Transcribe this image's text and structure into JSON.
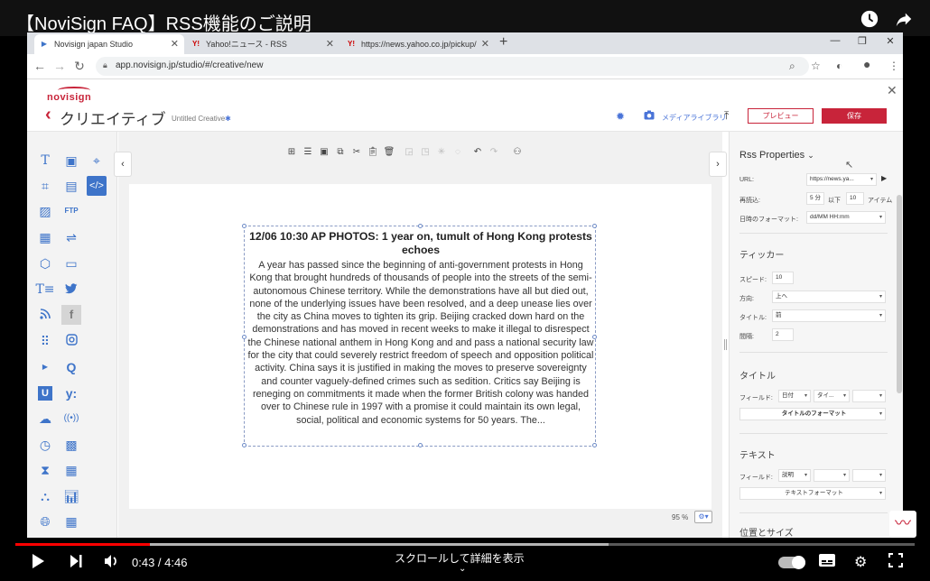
{
  "video": {
    "title": "【NoviSign FAQ】RSS機能のご説明",
    "time_current": "0:43",
    "time_total": "4:46",
    "time_sep": " / ",
    "scroll_hint": "スクロールして詳細を表示",
    "progress": 0.15,
    "buffered": 0.66
  },
  "browser": {
    "tabs": [
      {
        "label": "Novisign japan Studio",
        "icon": "play-icon",
        "active": true
      },
      {
        "label": "Yahoo!ニュース - RSS",
        "icon": "yahoo-icon",
        "active": false
      },
      {
        "label": "https://news.yahoo.co.jp/pickup/",
        "icon": "yahoo-icon",
        "active": false
      }
    ],
    "url": "app.novisign.jp/studio/#/creative/new"
  },
  "app": {
    "logo_text": "novisign",
    "page_title": "クリエイティブ",
    "creative_name": "Untitled Creative",
    "creative_modified_mark": "✱",
    "media_library": "メディアライブラリ",
    "preview_label": "プレビュー",
    "save_label": "保存"
  },
  "canvas": {
    "zoom": "95 %",
    "rss_title": "12/06 10:30 AP PHOTOS: 1 year on, tumult of Hong Kong protests echoes",
    "rss_body": "A year has passed since the beginning of anti-government protests in Hong Kong that brought hundreds of thousands of people into the streets of the semi-autonomous Chinese territory. While the demonstrations have all but died out, none of the underlying issues have been resolved, and a deep unease lies over the city as China moves to tighten its grip. Beijing cracked down hard on the demonstrations and has moved in recent weeks to make it illegal to disrespect the Chinese national anthem in Hong Kong and and pass a national security law for the city that could severely restrict freedom of speech and opposition political activity. China says it is justified in making the moves to preserve sovereignty and counter vaguely-defined crimes such as sedition. Critics say Beijing is reneging on commitments it made when the former British colony was handed over to Chinese rule in 1997 with a promise it could maintain its own legal, social, political and economic systems for 50 years. The..."
  },
  "props": {
    "title": "Rss Properties",
    "url_label": "URL:",
    "url_value": "https://news.ya...",
    "reload_label": "再読込:",
    "reload_minutes": "5",
    "reload_unit": "分",
    "count_prefix": "以下",
    "count_value": "10",
    "count_unit": "アイテム",
    "date_format_label": "日時のフォーマット:",
    "date_format_value": "dd/MM HH:mm",
    "ticker_header": "ティッカー",
    "speed_label": "スピード:",
    "speed_value": "10",
    "direction_label": "方向:",
    "direction_value": "上へ",
    "ticker_title_label": "タイトル:",
    "ticker_title_value": "前",
    "interval_label": "間隔:",
    "interval_value": "2",
    "title_header": "タイトル",
    "title_field_label": "フィールド:",
    "title_field_1": "日付",
    "title_field_2": "タイ...",
    "title_format_button": "タイトルのフォーマット",
    "text_header": "テキスト",
    "text_field_label": "フィールド:",
    "text_field_1": "説明",
    "text_format_button": "テキストフォーマット",
    "position_header": "位置とサイズ"
  }
}
